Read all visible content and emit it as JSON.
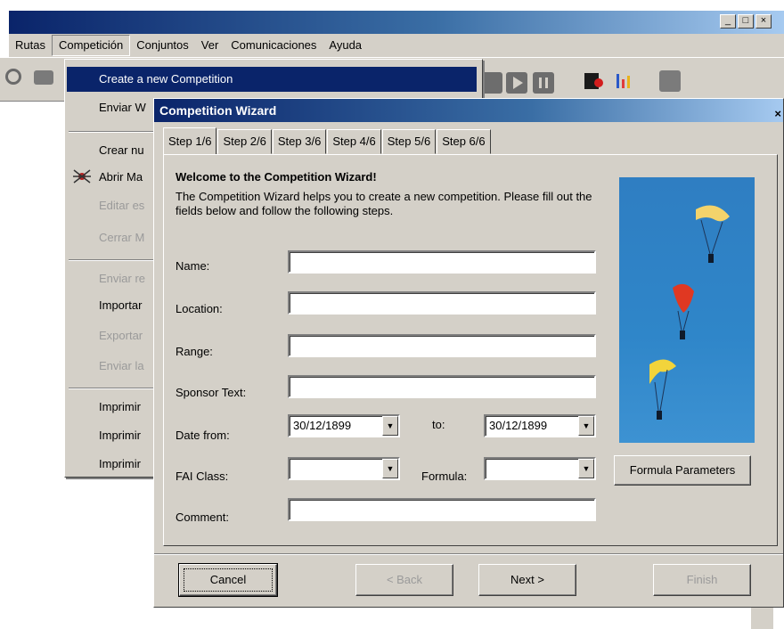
{
  "app": {
    "title_buttons": [
      "_",
      "□",
      "×"
    ],
    "menu": [
      "Rutas",
      "Competición",
      "Conjuntos",
      "Ver",
      "Comunicaciones",
      "Ayuda"
    ],
    "active_menu_index": 1
  },
  "dropdown": {
    "items": [
      {
        "label": "Create a new Competition",
        "highlighted": true,
        "disabled": false
      },
      {
        "label": "Enviar W",
        "disabled": false
      },
      {
        "label": "Crear nu",
        "disabled": false
      },
      {
        "label": "Abrir Ma",
        "disabled": false,
        "icon": "spider-icon"
      },
      {
        "label": "Editar es",
        "disabled": true
      },
      {
        "label": "Cerrar M",
        "disabled": true
      },
      {
        "label": "Enviar re",
        "disabled": true
      },
      {
        "label": "Importar",
        "disabled": false
      },
      {
        "label": "Exportar",
        "disabled": true
      },
      {
        "label": "Enviar la",
        "disabled": true
      },
      {
        "label": "Imprimir",
        "disabled": false
      },
      {
        "label": "Imprimir",
        "disabled": false
      },
      {
        "label": "Imprimir",
        "disabled": false
      }
    ]
  },
  "wizard": {
    "title": "Competition Wizard",
    "close": "×",
    "tabs": [
      "Step 1/6",
      "Step 2/6",
      "Step 3/6",
      "Step 4/6",
      "Step 5/6",
      "Step 6/6"
    ],
    "heading": "Welcome to the Competition Wizard!",
    "intro": "The Competition Wizard helps you to create a new competition. Please fill out the fields below and follow the following steps.",
    "fields": {
      "name_label": "Name:",
      "name_value": "",
      "location_label": "Location:",
      "location_value": "",
      "range_label": "Range:",
      "range_value": "",
      "sponsor_label": "Sponsor Text:",
      "sponsor_value": "",
      "date_from_label": "Date from:",
      "date_from_value": "30/12/1899",
      "to_label": "to:",
      "date_to_value": "30/12/1899",
      "fai_class_label": "FAI Class:",
      "fai_class_value": "",
      "formula_label": "Formula:",
      "formula_value": "",
      "comment_label": "Comment:",
      "comment_value": ""
    },
    "formula_params_button": "Formula Parameters",
    "buttons": {
      "cancel": "Cancel",
      "back": "< Back",
      "next": "Next >",
      "finish": "Finish"
    },
    "combo_arrow": "▼",
    "colors": {
      "titlebar": "#0a246a",
      "sky": "#2f86c9",
      "highlight": "#0a246a"
    }
  }
}
